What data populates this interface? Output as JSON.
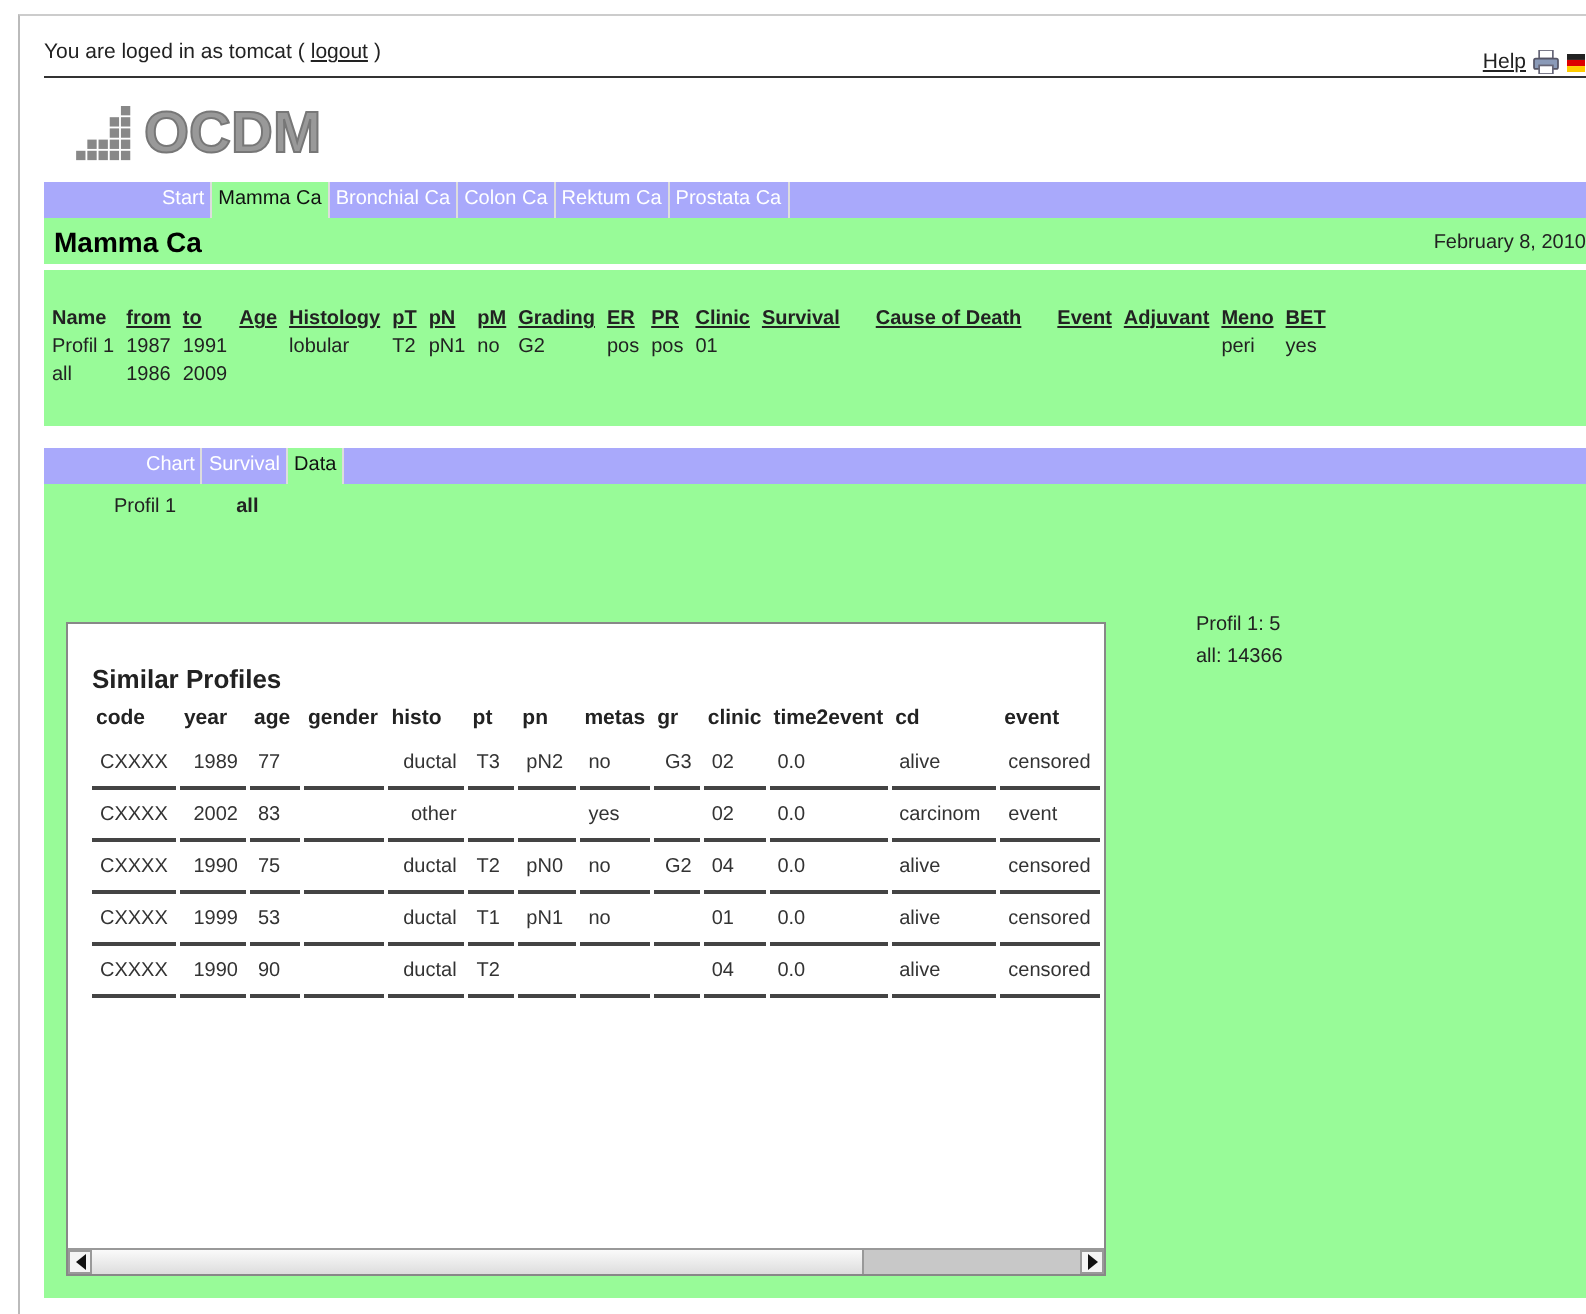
{
  "header": {
    "login_text": "You are loged in as tomcat (",
    "logout_link": "logout",
    "login_close": ")",
    "help_link": "Help"
  },
  "logo": {
    "text": "OCDM"
  },
  "main_tabs": [
    {
      "label": "Start",
      "selected": false
    },
    {
      "label": "Mamma Ca",
      "selected": true
    },
    {
      "label": "Bronchial Ca",
      "selected": false
    },
    {
      "label": "Colon Ca",
      "selected": false
    },
    {
      "label": "Rektum Ca",
      "selected": false
    },
    {
      "label": "Prostata Ca",
      "selected": false
    }
  ],
  "page": {
    "title": "Mamma Ca",
    "date": "February 8, 2010"
  },
  "profile_table": {
    "columns": [
      {
        "label": "Name",
        "underlined": false
      },
      {
        "label": "from",
        "underlined": true
      },
      {
        "label": "to",
        "underlined": true
      },
      {
        "label": "Age",
        "underlined": true
      },
      {
        "label": "Histology",
        "underlined": true
      },
      {
        "label": "pT",
        "underlined": true
      },
      {
        "label": "pN",
        "underlined": true
      },
      {
        "label": "pM",
        "underlined": true
      },
      {
        "label": "Grading",
        "underlined": true
      },
      {
        "label": "ER",
        "underlined": true
      },
      {
        "label": "PR",
        "underlined": true
      },
      {
        "label": "Clinic",
        "underlined": true
      },
      {
        "label": "Survival",
        "underlined": true
      },
      {
        "label": "Cause of Death",
        "underlined": true
      },
      {
        "label": "Event",
        "underlined": true
      },
      {
        "label": "Adjuvant",
        "underlined": true
      },
      {
        "label": "Meno",
        "underlined": true
      },
      {
        "label": "BET",
        "underlined": true
      }
    ],
    "rows": [
      [
        "Profil 1",
        "1987",
        "1991",
        null,
        "lobular",
        "T2",
        "pN1",
        "no",
        "G2",
        "pos",
        "pos",
        "01",
        null,
        null,
        null,
        null,
        "peri",
        "yes"
      ],
      [
        "all",
        "1986",
        "2009",
        null,
        null,
        null,
        null,
        null,
        null,
        null,
        null,
        null,
        null,
        null,
        null,
        null,
        null,
        null
      ]
    ]
  },
  "sub_tabs": [
    {
      "label": "Chart",
      "selected": false
    },
    {
      "label": "Survival",
      "selected": false
    },
    {
      "label": "Data",
      "selected": true
    }
  ],
  "profile_selector": [
    {
      "label": "Profil 1",
      "selected": false
    },
    {
      "label": "all",
      "selected": true
    }
  ],
  "similar_profiles": {
    "title": "Similar Profiles",
    "columns": [
      "code",
      "year",
      "age",
      "gender",
      "histo",
      "pt",
      "pn",
      "metas",
      "gr",
      "clinic",
      "time2event",
      "cd",
      "event"
    ],
    "rows": [
      [
        "CXXXX",
        "1989",
        "77",
        null,
        "ductal",
        "T3",
        "pN2",
        "no",
        "G3",
        "02",
        "0.0",
        "alive",
        "censored"
      ],
      [
        "CXXXX",
        "2002",
        "83",
        null,
        "other",
        null,
        null,
        "yes",
        null,
        "02",
        "0.0",
        "carcinom",
        "event"
      ],
      [
        "CXXXX",
        "1990",
        "75",
        null,
        "ductal",
        "T2",
        "pN0",
        "no",
        "G2",
        "04",
        "0.0",
        "alive",
        "censored"
      ],
      [
        "CXXXX",
        "1999",
        "53",
        null,
        "ductal",
        "T1",
        "pN1",
        "no",
        null,
        "01",
        "0.0",
        "alive",
        "censored"
      ],
      [
        "CXXXX",
        "1990",
        "90",
        null,
        "ductal",
        "T2",
        null,
        null,
        null,
        "04",
        "0.0",
        "alive",
        "censored"
      ]
    ]
  },
  "counts": [
    "Profil 1: 5",
    "all: 14366"
  ]
}
